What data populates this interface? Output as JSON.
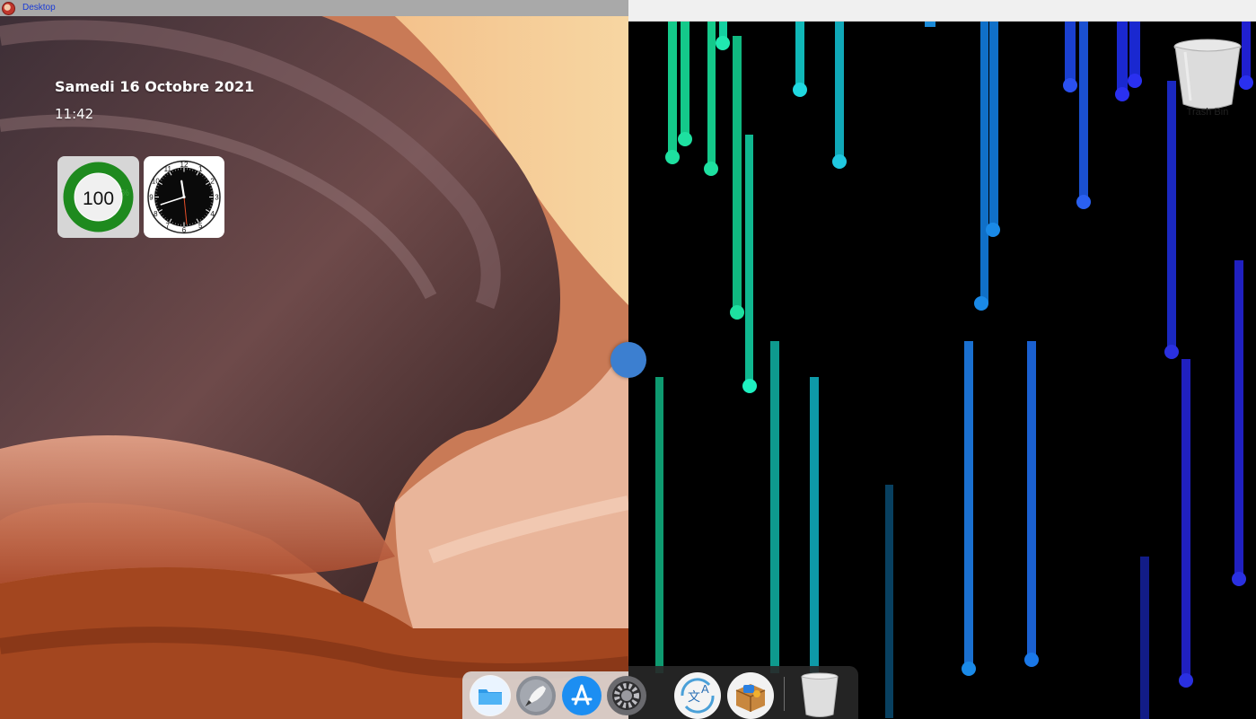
{
  "window": {
    "title": "Desktop"
  },
  "desktop": {
    "date": "Samedi 16 Octobre 2021",
    "time": "11:42"
  },
  "widgets": {
    "battery": {
      "value": "100",
      "unit": "%",
      "level": 1.0,
      "color": "#1e8a1e"
    },
    "clock": {
      "hour": 11,
      "minute": 42,
      "numerals": [
        "12",
        "1",
        "2",
        "3",
        "4",
        "5",
        "6",
        "7",
        "8",
        "9",
        "10",
        "11"
      ]
    }
  },
  "trash": {
    "label": "Trash Bin"
  },
  "dock": {
    "items": [
      {
        "name": "finder",
        "icon": "folder-icon"
      },
      {
        "name": "launchpad",
        "icon": "rocket-icon"
      },
      {
        "name": "app-store",
        "icon": "app-store-icon"
      },
      {
        "name": "system-preferences",
        "icon": "gear-icon"
      },
      {
        "name": "translate",
        "icon": "translate-icon"
      },
      {
        "name": "archive",
        "icon": "package-icon"
      },
      {
        "name": "trash",
        "icon": "trash-icon"
      }
    ]
  },
  "colors": {
    "accent": "#3c7fd0",
    "titlebar": "#a9a9a9",
    "title_text": "#1a3bd6"
  }
}
